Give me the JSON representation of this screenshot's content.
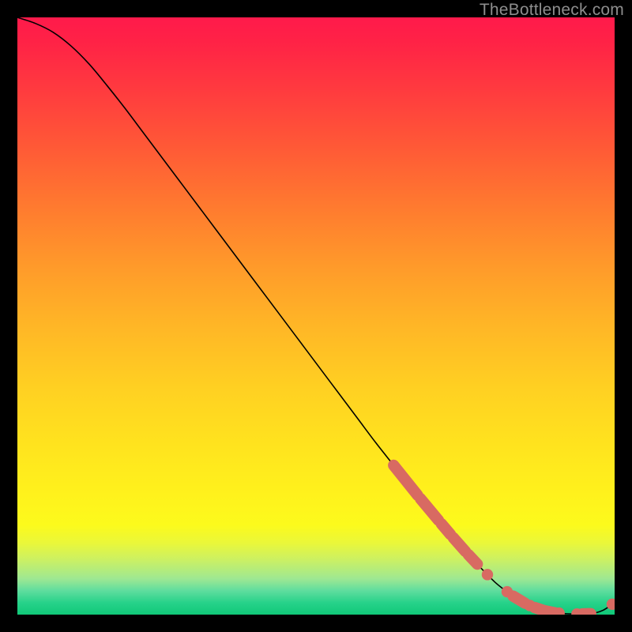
{
  "attribution": "TheBottleneck.com",
  "colors": {
    "page_bg": "#000000",
    "curve": "#000000",
    "marker": "#d86a62",
    "attribution_text": "#8d8d8d"
  },
  "chart_data": {
    "type": "line",
    "title": "",
    "xlabel": "",
    "ylabel": "",
    "xlim": [
      0,
      100
    ],
    "ylim": [
      0,
      100
    ],
    "grid": false,
    "legend": false,
    "series": [
      {
        "name": "bottleneck-curve",
        "x": [
          0,
          3,
          6,
          9,
          12,
          15,
          18,
          21,
          24,
          27,
          30,
          33,
          36,
          39,
          42,
          45,
          48,
          51,
          54,
          57,
          60,
          63,
          66,
          69,
          72,
          75,
          78,
          80,
          82,
          84,
          86,
          88,
          90,
          92,
          94,
          96,
          98,
          100
        ],
        "y": [
          100,
          99,
          97.5,
          95.2,
          92.2,
          88.6,
          84.8,
          80.8,
          76.8,
          72.8,
          68.8,
          64.8,
          60.8,
          56.8,
          52.8,
          48.8,
          44.8,
          40.8,
          36.8,
          32.8,
          28.8,
          25.0,
          21.2,
          17.6,
          14.0,
          10.6,
          7.4,
          5.4,
          3.8,
          2.4,
          1.4,
          0.7,
          0.3,
          0.15,
          0.1,
          0.15,
          0.7,
          2.0
        ]
      }
    ],
    "markers": {
      "name": "highlight-points",
      "segments": [
        {
          "x_start": 63,
          "x_end": 67,
          "shape": "pill"
        },
        {
          "x_start": 67.5,
          "x_end": 70.5,
          "shape": "pill"
        },
        {
          "x_start": 71,
          "x_end": 72.5,
          "shape": "pill"
        },
        {
          "x_start": 73,
          "x_end": 75,
          "shape": "pill"
        },
        {
          "x_start": 75.5,
          "x_end": 77,
          "shape": "pill"
        },
        {
          "x_start": 78.2,
          "x_end": 79.2,
          "shape": "dot"
        },
        {
          "x_start": 81.5,
          "x_end": 82.5,
          "shape": "dot"
        },
        {
          "x_start": 83,
          "x_end": 85,
          "shape": "pill"
        },
        {
          "x_start": 85.3,
          "x_end": 86.3,
          "shape": "dot"
        },
        {
          "x_start": 86.6,
          "x_end": 88.2,
          "shape": "pill"
        },
        {
          "x_start": 88.5,
          "x_end": 90,
          "shape": "pill"
        },
        {
          "x_start": 90.2,
          "x_end": 91.2,
          "shape": "dot"
        },
        {
          "x_start": 93.2,
          "x_end": 94.2,
          "shape": "dot"
        },
        {
          "x_start": 94.6,
          "x_end": 96,
          "shape": "pill"
        },
        {
          "x_start": 99.2,
          "x_end": 100,
          "shape": "dot"
        }
      ]
    }
  }
}
